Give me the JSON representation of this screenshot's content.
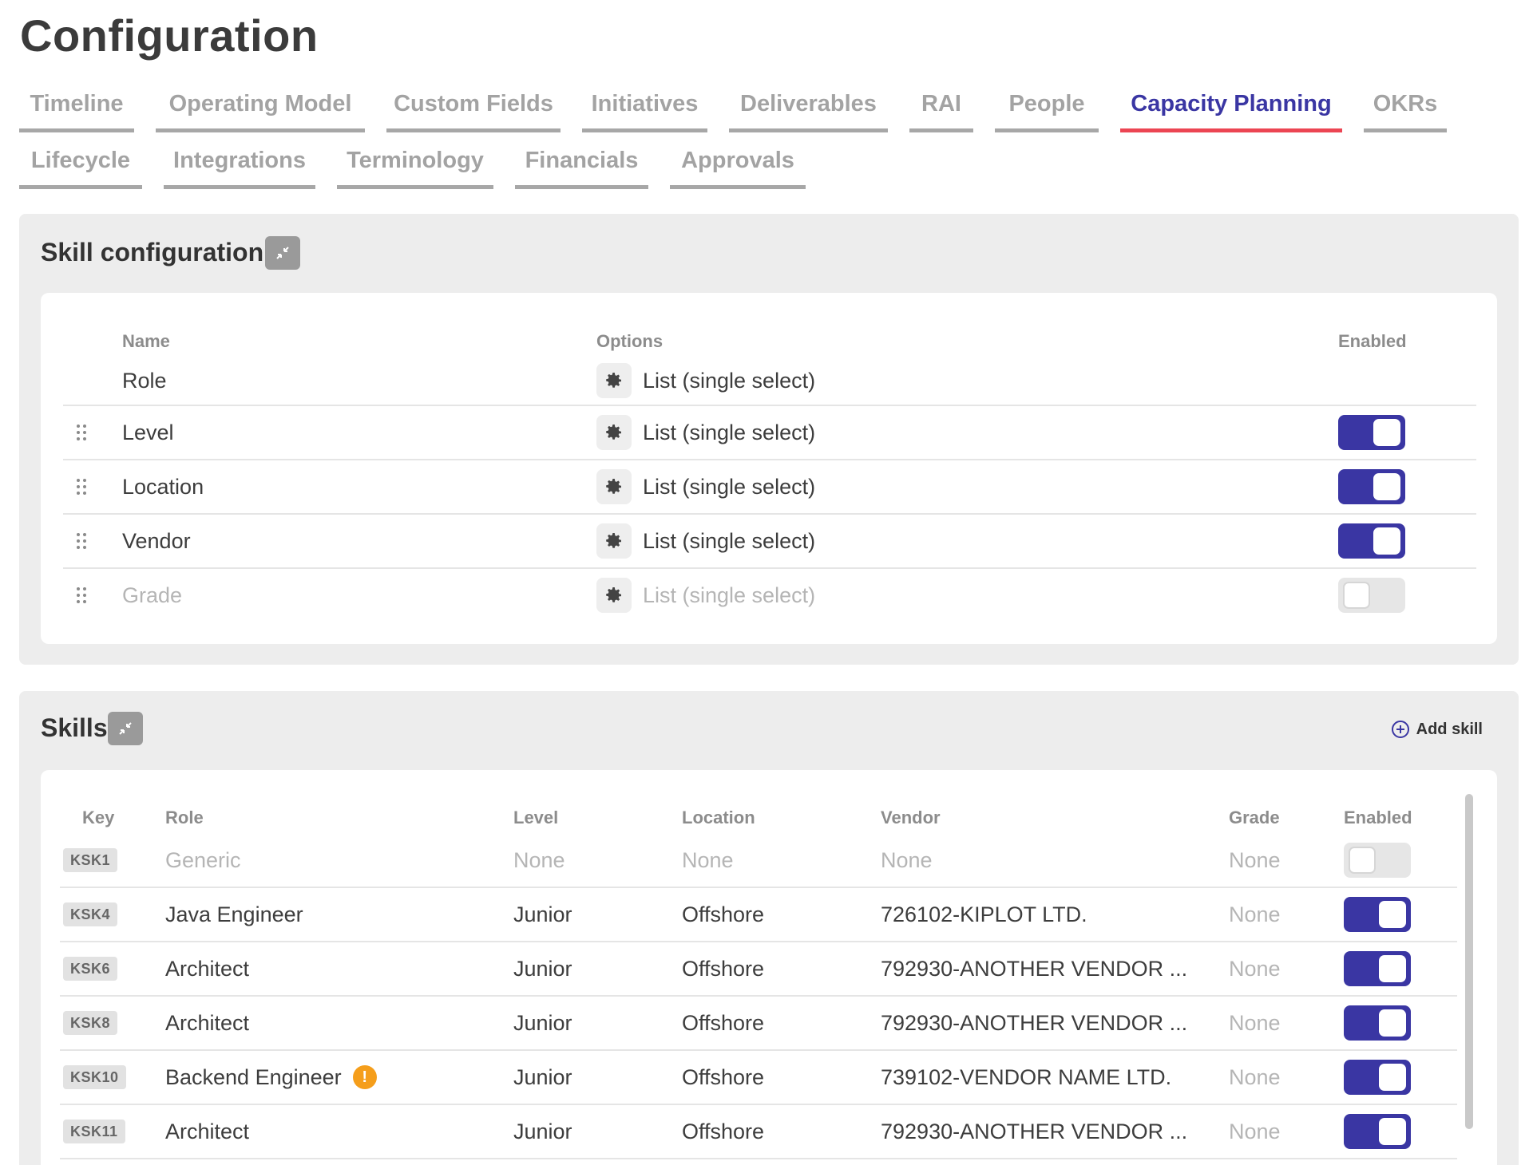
{
  "page": {
    "title": "Configuration"
  },
  "tabs": [
    {
      "label": "Timeline",
      "active": false
    },
    {
      "label": "Operating Model",
      "active": false
    },
    {
      "label": "Custom Fields",
      "active": false
    },
    {
      "label": "Initiatives",
      "active": false
    },
    {
      "label": "Deliverables",
      "active": false
    },
    {
      "label": "RAI",
      "active": false
    },
    {
      "label": "People",
      "active": false
    },
    {
      "label": "Capacity Planning",
      "active": true
    },
    {
      "label": "OKRs",
      "active": false
    },
    {
      "label": "Lifecycle",
      "active": false
    },
    {
      "label": "Integrations",
      "active": false
    },
    {
      "label": "Terminology",
      "active": false
    },
    {
      "label": "Financials",
      "active": false
    },
    {
      "label": "Approvals",
      "active": false
    }
  ],
  "skill_config": {
    "title": "Skill configuration",
    "collapse_icon": "collapse-arrows-icon",
    "headers": {
      "name": "Name",
      "options": "Options",
      "enabled": "Enabled"
    },
    "rows": [
      {
        "name": "Role",
        "option": "List (single select)",
        "enabled": null,
        "muted": false
      },
      {
        "name": "Level",
        "option": "List (single select)",
        "enabled": true,
        "muted": false
      },
      {
        "name": "Location",
        "option": "List (single select)",
        "enabled": true,
        "muted": false
      },
      {
        "name": "Vendor",
        "option": "List (single select)",
        "enabled": true,
        "muted": false
      },
      {
        "name": "Grade",
        "option": "List (single select)",
        "enabled": false,
        "muted": true
      }
    ]
  },
  "skills": {
    "title": "Skills",
    "add_label": "Add skill",
    "headers": {
      "key": "Key",
      "role": "Role",
      "level": "Level",
      "location": "Location",
      "vendor": "Vendor",
      "grade": "Grade",
      "enabled": "Enabled"
    },
    "rows": [
      {
        "key": "KSK1",
        "role": "Generic",
        "level": "None",
        "location": "None",
        "vendor": "None",
        "grade": "None",
        "enabled": false,
        "muted": true,
        "warning": false
      },
      {
        "key": "KSK4",
        "role": "Java Engineer",
        "level": "Junior",
        "location": "Offshore",
        "vendor": "726102-KIPLOT LTD.",
        "grade": "None",
        "enabled": true,
        "muted": false,
        "warning": false
      },
      {
        "key": "KSK6",
        "role": "Architect",
        "level": "Junior",
        "location": "Offshore",
        "vendor": "792930-ANOTHER VENDOR ...",
        "grade": "None",
        "enabled": true,
        "muted": false,
        "warning": false
      },
      {
        "key": "KSK8",
        "role": "Architect",
        "level": "Junior",
        "location": "Offshore",
        "vendor": "792930-ANOTHER VENDOR ...",
        "grade": "None",
        "enabled": true,
        "muted": false,
        "warning": false
      },
      {
        "key": "KSK10",
        "role": "Backend Engineer",
        "level": "Junior",
        "location": "Offshore",
        "vendor": "739102-VENDOR NAME LTD.",
        "grade": "None",
        "enabled": true,
        "muted": false,
        "warning": true,
        "warning_text": "!"
      },
      {
        "key": "KSK11",
        "role": "Architect",
        "level": "Junior",
        "location": "Offshore",
        "vendor": "792930-ANOTHER VENDOR ...",
        "grade": "None",
        "enabled": true,
        "muted": false,
        "warning": false
      }
    ]
  },
  "colors": {
    "accent": "#3a36a3",
    "active_tab_underline": "#ec4553",
    "warning": "#f59e1b"
  }
}
